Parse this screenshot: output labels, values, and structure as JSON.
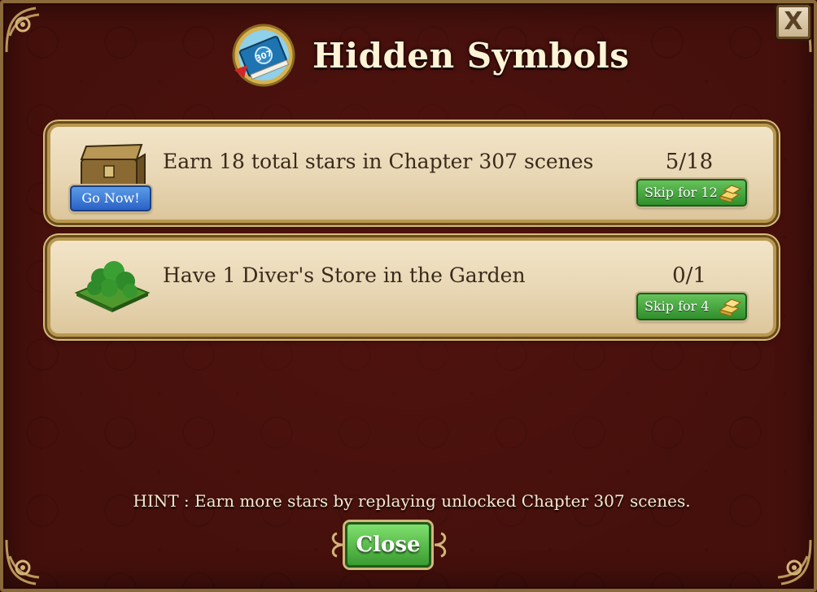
{
  "dialog": {
    "title": "Hidden Symbols",
    "book_badge": "307",
    "close_x_label": "X"
  },
  "tasks": [
    {
      "icon": "treasure-chest-icon",
      "text": "Earn 18 total stars in Chapter 307 scenes",
      "progress_text": "5/18",
      "current": 5,
      "total": 18,
      "go_now_label": "Go Now!",
      "skip_label": "Skip for 12"
    },
    {
      "icon": "garden-trees-icon",
      "text": "Have 1 Diver's Store in the Garden",
      "progress_text": "0/1",
      "current": 0,
      "total": 1,
      "skip_label": "Skip for 4"
    }
  ],
  "hint": "HINT : Earn more stars by replaying unlocked Chapter 307 scenes.",
  "footer": {
    "close_label": "Close"
  },
  "colors": {
    "background": "#45100c",
    "panel": "#ecdcba",
    "go_now": "#2a62c6",
    "skip": "#3a9b30",
    "close": "#4fb040",
    "title_text": "#fff4d6"
  },
  "icons": [
    "book-icon",
    "gold-bars-icon",
    "close-x-icon",
    "corner-ornament-icon"
  ]
}
